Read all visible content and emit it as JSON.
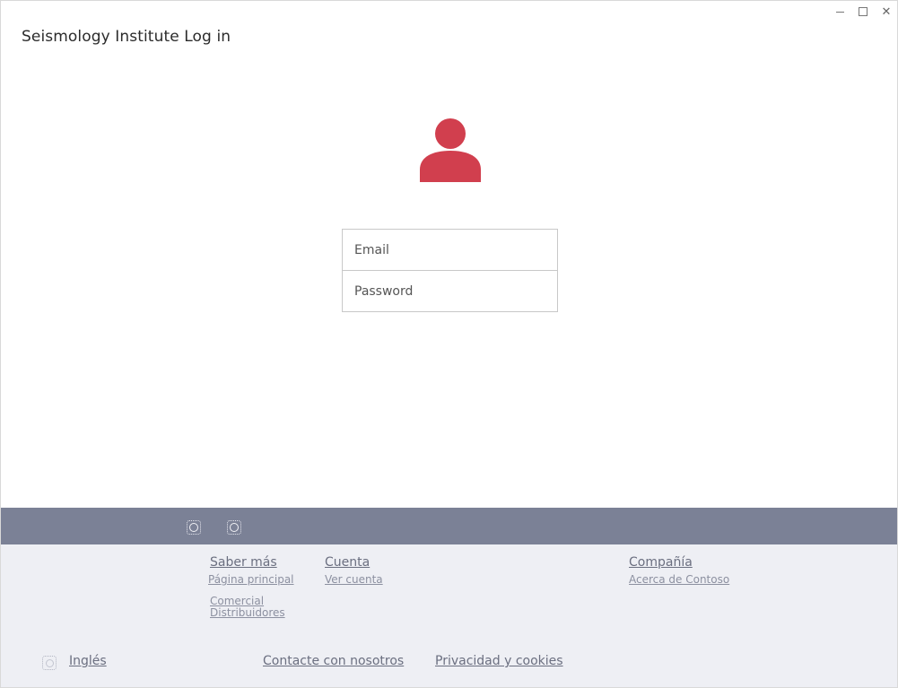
{
  "window": {
    "title": "Seismology Institute Log in"
  },
  "login": {
    "email_placeholder": "Email",
    "password_placeholder": "Password"
  },
  "colors": {
    "accent": "#d13f4e",
    "footer_bar": "#7b8196",
    "footer_bg": "#eeeff4"
  },
  "footer": {
    "columns": [
      {
        "heading": "Saber más",
        "links": [
          "Página principal",
          "Comercial",
          "Distribuidores"
        ]
      },
      {
        "heading": "Cuenta",
        "links": [
          "Ver cuenta"
        ]
      },
      {
        "heading": "Compañía",
        "links": [
          "Acerca de Contoso"
        ]
      }
    ],
    "language": "Inglés",
    "contact": "Contacte con nosotros",
    "privacy": "Privacidad y cookies"
  }
}
